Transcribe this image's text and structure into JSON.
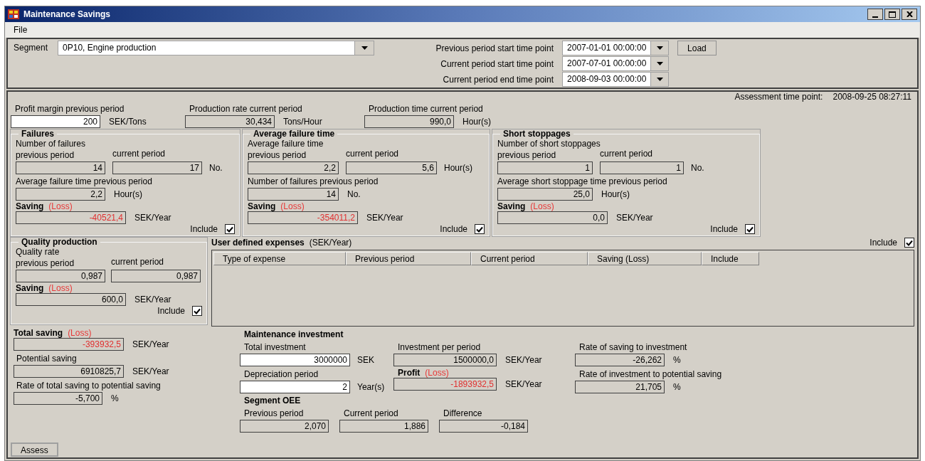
{
  "window": {
    "title": "Maintenance Savings"
  },
  "menu": [
    "File"
  ],
  "segment": {
    "label": "Segment",
    "value": "0P10, Engine production"
  },
  "time_points": [
    {
      "label": "Previous period start time point",
      "value": "2007-01-01 00:00:00"
    },
    {
      "label": "Current period start time point",
      "value": "2007-07-01 00:00:00"
    },
    {
      "label": "Current period end time point",
      "value": "2008-09-03 00:00:00"
    }
  ],
  "load_button": "Load",
  "assessment": {
    "label": "Assessment time point:",
    "value": "2008-09-25 08:27:11"
  },
  "top_fields": [
    {
      "label": "Profit margin previous period",
      "value": "200",
      "unit": "SEK/Tons",
      "editable": true
    },
    {
      "label": "Production rate current period",
      "value": "30,434",
      "unit": "Tons/Hour",
      "editable": false
    },
    {
      "label": "Production time current period",
      "value": "990,0",
      "unit": "Hour(s)",
      "editable": false
    }
  ],
  "groups": [
    {
      "title": "Failures",
      "caption": "Number of failures",
      "col_labels": [
        "previous period",
        "current period"
      ],
      "values": [
        "14",
        "17"
      ],
      "unit": "No.",
      "second_label": "Average failure time previous period",
      "second_value": "2,2",
      "second_unit": "Hour(s)",
      "saving_label": "Saving",
      "loss_label": "(Loss)",
      "saving_value": "-40521,4",
      "negative": true,
      "saving_unit": "SEK/Year",
      "include_label": "Include",
      "include": true
    },
    {
      "title": "Average failure time",
      "caption": "Average failure time",
      "col_labels": [
        "previous period",
        "current period"
      ],
      "values": [
        "2,2",
        "5,6"
      ],
      "unit": "Hour(s)",
      "second_label": "Number of failures previous period",
      "second_value": "14",
      "second_unit": "No.",
      "saving_label": "Saving",
      "loss_label": "(Loss)",
      "saving_value": "-354011,2",
      "negative": true,
      "saving_unit": "SEK/Year",
      "include_label": "Include",
      "include": true
    },
    {
      "title": "Short stoppages",
      "caption": "Number of short stoppages",
      "col_labels": [
        "previous period",
        "current period"
      ],
      "values": [
        "1",
        "1"
      ],
      "unit": "No.",
      "second_label": "Average short stoppage time previous period",
      "second_value": "25,0",
      "second_unit": "Hour(s)",
      "saving_label": "Saving",
      "loss_label": "(Loss)",
      "saving_value": "0,0",
      "negative": false,
      "saving_unit": "SEK/Year",
      "include_label": "Include",
      "include": true
    }
  ],
  "quality": {
    "title": "Quality production",
    "caption": "Quality rate",
    "col_labels": [
      "previous period",
      "current period"
    ],
    "values": [
      "0,987",
      "0,987"
    ],
    "saving_label": "Saving",
    "loss_label": "(Loss)",
    "saving_value": "600,0",
    "negative": false,
    "saving_unit": "SEK/Year",
    "include_label": "Include",
    "include": true
  },
  "user_expenses": {
    "title": "User defined expenses",
    "suffix": "(SEK/Year)",
    "include_label": "Include",
    "include": true,
    "columns": [
      "Type of expense",
      "Previous period",
      "Current period",
      "Saving (Loss)",
      "Include"
    ]
  },
  "totals": {
    "total_saving": {
      "label": "Total saving",
      "loss_label": "(Loss)",
      "value": "-393932,5",
      "negative": true,
      "unit": "SEK/Year"
    },
    "potential": {
      "label": "Potential saving",
      "value": "6910825,7",
      "unit": "SEK/Year"
    },
    "rate": {
      "label": "Rate of total saving to potential saving",
      "value": "-5,700",
      "unit": "%"
    }
  },
  "investment": {
    "title": "Maintenance investment",
    "total": {
      "label": "Total investment",
      "value": "3000000",
      "unit": "SEK",
      "editable": true
    },
    "per_period": {
      "label": "Investment per period",
      "value": "1500000,0",
      "unit": "SEK/Year",
      "editable": false
    },
    "rate_saving": {
      "label": "Rate of saving to investment",
      "value": "-26,262",
      "unit": "%",
      "editable": false
    },
    "depreciation": {
      "label": "Depreciation period",
      "value": "2",
      "unit": "Year(s)",
      "editable": true
    },
    "profit": {
      "label": "Profit",
      "loss_label": "(Loss)",
      "value": "-1893932,5",
      "negative": true,
      "unit": "SEK/Year"
    },
    "rate_investment": {
      "label": "Rate of investment to potential saving",
      "value": "21,705",
      "unit": "%",
      "editable": false
    }
  },
  "oee": {
    "title": "Segment OEE",
    "fields": [
      {
        "label": "Previous period",
        "value": "2,070"
      },
      {
        "label": "Current period",
        "value": "1,886"
      },
      {
        "label": "Difference",
        "value": "-0,184"
      }
    ]
  },
  "assess_button": "Assess"
}
